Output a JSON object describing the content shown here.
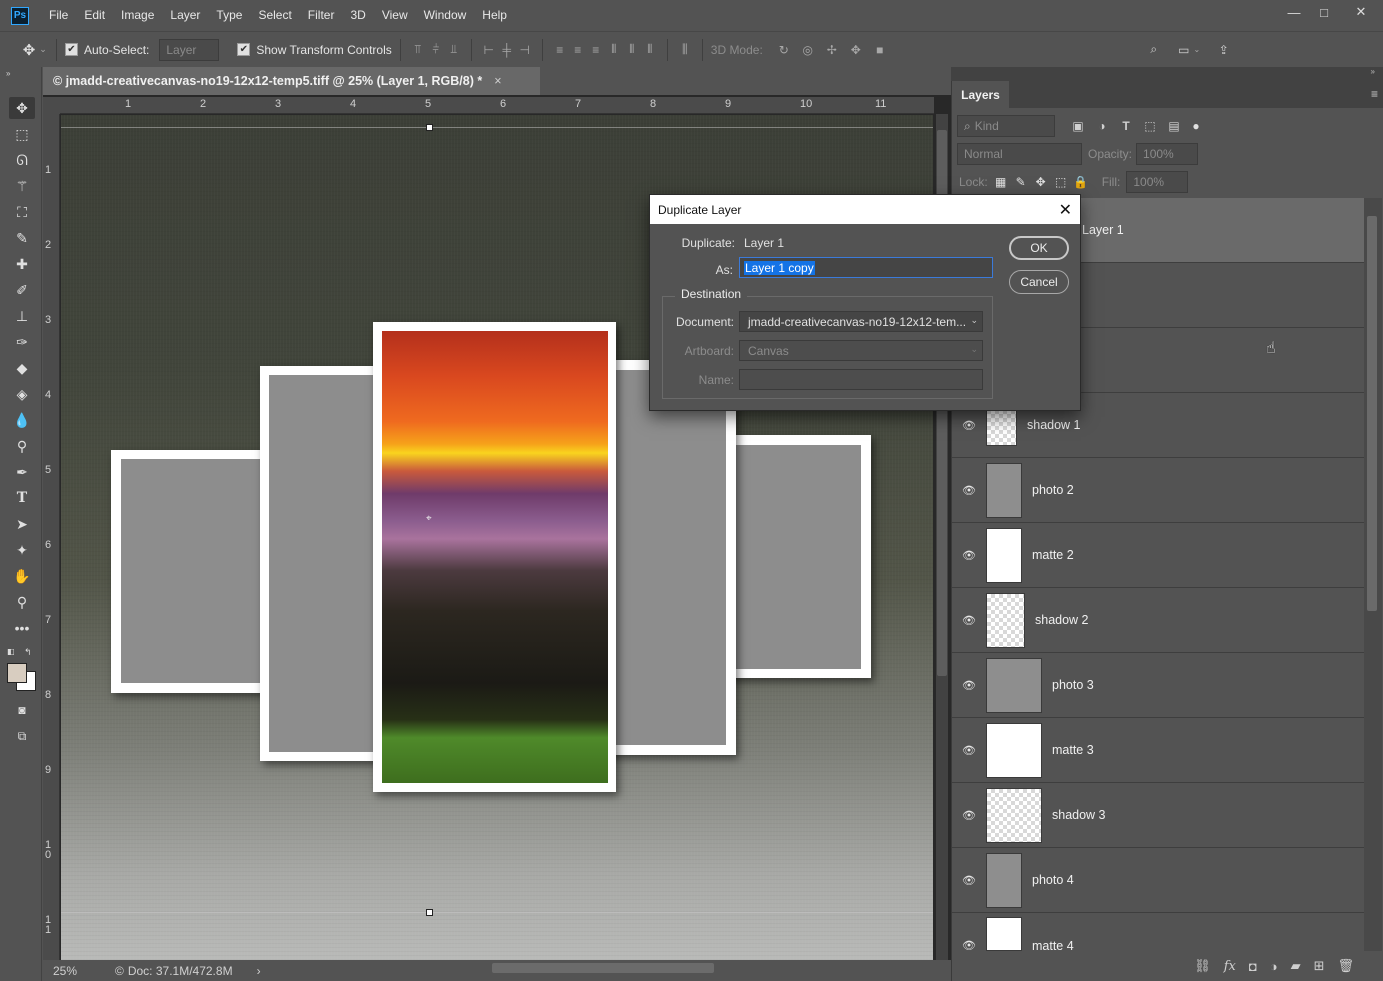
{
  "app": {
    "logo_text": "Ps"
  },
  "menu": [
    "File",
    "Edit",
    "Image",
    "Layer",
    "Type",
    "Select",
    "Filter",
    "3D",
    "View",
    "Window",
    "Help"
  ],
  "window_controls": {
    "minimize": "—",
    "restore": "□",
    "close": "✕"
  },
  "options_bar": {
    "auto_select_label": "Auto-Select:",
    "auto_select_target": "Layer",
    "show_transform_label": "Show Transform Controls",
    "mode_3d_label": "3D Mode:"
  },
  "document": {
    "tab_title": "© jmadd-creativecanvas-no19-12x12-temp5.tiff @ 25% (Layer 1, RGB/8) *",
    "tab_close": "×",
    "ruler_h": [
      "1",
      "2",
      "3",
      "4",
      "5",
      "6",
      "7",
      "8",
      "9",
      "10",
      "11"
    ],
    "ruler_v": [
      "1",
      "2",
      "3",
      "4",
      "5",
      "6",
      "7",
      "8",
      "9",
      "1\n0",
      "1\n1"
    ]
  },
  "status_bar": {
    "zoom": "25%",
    "doc_info": "Doc: 37.1M/472.8M",
    "arrow": "›"
  },
  "layers_panel": {
    "tab_label": "Layers",
    "filter_kind": "Kind",
    "blend_mode": "Normal",
    "opacity_label": "Opacity:",
    "opacity_value": "100%",
    "lock_label": "Lock:",
    "fill_label": "Fill:",
    "fill_value": "100%",
    "selected_layer_label": "Layer 1",
    "layers": [
      {
        "name": "shadow 1",
        "thumb": "check"
      },
      {
        "name": "photo 2",
        "thumb": "gray"
      },
      {
        "name": "matte 2",
        "thumb": "white"
      },
      {
        "name": "shadow 2",
        "thumb": "check"
      },
      {
        "name": "photo 3",
        "thumb": "gray"
      },
      {
        "name": "matte 3",
        "thumb": "white"
      },
      {
        "name": "shadow 3",
        "thumb": "check"
      },
      {
        "name": "photo 4",
        "thumb": "gray"
      },
      {
        "name": "matte 4",
        "thumb": "white"
      }
    ]
  },
  "dialog": {
    "title": "Duplicate Layer",
    "duplicate_label": "Duplicate:",
    "duplicate_value": "Layer 1",
    "as_label": "As:",
    "as_value": "Layer 1 copy",
    "destination_title": "Destination",
    "document_label": "Document:",
    "document_value": "jmadd-creativecanvas-no19-12x12-tem...",
    "artboard_label": "Artboard:",
    "artboard_value": "Canvas",
    "name_label": "Name:",
    "ok_label": "OK",
    "cancel_label": "Cancel"
  },
  "colors": {
    "accent": "#1473e6",
    "ps_blue": "#31a8ff",
    "ui_gray": "#535353"
  }
}
